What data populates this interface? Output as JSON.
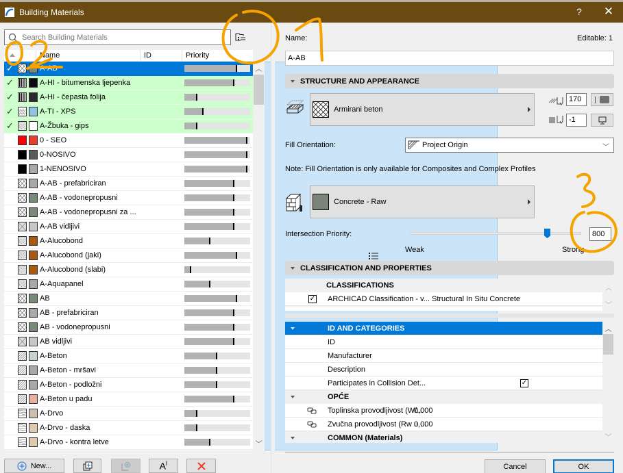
{
  "window": {
    "title": "Building Materials",
    "help_label": "?",
    "close_label": "✕",
    "title_bar_color": "#6a4a10"
  },
  "left": {
    "search_placeholder": "Search Building Materials",
    "view_modes": [
      "folder-view",
      "list-view"
    ],
    "active_view": "list-view",
    "columns": {
      "name": "Name",
      "id": "ID",
      "priority": "Priority"
    },
    "materials": [
      {
        "name": "A-AB",
        "in_use": true,
        "selected": true,
        "fill": "crosshatch",
        "surface": "#7a8a78",
        "priority": 0.8
      },
      {
        "name": "A-HI - bitumenska ljepenka",
        "in_use": true,
        "fill": "vbars",
        "surface": "#0a0a10",
        "priority": 0.76
      },
      {
        "name": "A-HI - čepasta folija",
        "in_use": true,
        "fill": "vbars",
        "surface": "#2a2a2a",
        "priority": 0.2
      },
      {
        "name": "A-TI - XPS",
        "in_use": true,
        "fill": "zigzag",
        "surface": "#8fc3e3",
        "priority": 0.29
      },
      {
        "name": "A-Žbuka - gips",
        "in_use": true,
        "fill": "dots",
        "surface": "#ffffff",
        "priority": 0.2
      },
      {
        "name": "0 - SEO",
        "fill": "solid-red",
        "surface": "#e8402a",
        "priority": 0.96
      },
      {
        "name": "0-NOSIVO",
        "fill": "solid-black",
        "surface": "#5a5a5a",
        "priority": 0.96
      },
      {
        "name": "1-NENOSIVO",
        "fill": "solid-black",
        "surface": "#a8a8a8",
        "priority": 0.96
      },
      {
        "name": "A-AB - prefabriciran",
        "fill": "crosshatch",
        "surface": "#a8a8a8",
        "priority": 0.76
      },
      {
        "name": "A-AB - vodonepropusni",
        "fill": "crosshatch",
        "surface": "#7a8a78",
        "priority": 0.76
      },
      {
        "name": "A-AB - vodonepropusni za ...",
        "fill": "crosshatch",
        "surface": "#7a8a78",
        "priority": 0.76
      },
      {
        "name": "A-AB vidljivi",
        "fill": "crosshatch-gray",
        "surface": "#c8c8c8",
        "priority": 0.76
      },
      {
        "name": "A-Alucobond",
        "fill": "dots",
        "surface": "#a85a10",
        "priority": 0.4
      },
      {
        "name": "A-Alucobond (jaki)",
        "fill": "dots",
        "surface": "#a85a10",
        "priority": 0.8
      },
      {
        "name": "A-Alucobond (slabi)",
        "fill": "dots",
        "surface": "#a85a10",
        "priority": 0.1
      },
      {
        "name": "A-Aquapanel",
        "fill": "dots",
        "surface": "#a8a8a8",
        "priority": 0.4
      },
      {
        "name": "AB",
        "fill": "crosshatch",
        "surface": "#7a8a78",
        "priority": 0.8
      },
      {
        "name": "AB - prefabriciran",
        "fill": "crosshatch",
        "surface": "#a8a8a8",
        "priority": 0.76
      },
      {
        "name": "AB - vodonepropusni",
        "fill": "crosshatch",
        "surface": "#7a8a78",
        "priority": 0.76
      },
      {
        "name": "AB vidljivi",
        "fill": "crosshatch-gray",
        "surface": "#c8c8c8",
        "priority": 0.76
      },
      {
        "name": "A-Beton",
        "fill": "diagonal",
        "surface": "#c8d0d0",
        "priority": 0.5
      },
      {
        "name": "A-Beton - mršavi",
        "fill": "diagonal",
        "surface": "#a8a8a8",
        "priority": 0.5
      },
      {
        "name": "A-Beton - podložni",
        "fill": "diagonal",
        "surface": "#a8a8a8",
        "priority": 0.5
      },
      {
        "name": "A-Beton u padu",
        "fill": "diagonal",
        "surface": "#e8b0a0",
        "priority": 0.76
      },
      {
        "name": "A-Drvo",
        "fill": "wood",
        "surface": "#cbbfae",
        "priority": 0.2
      },
      {
        "name": "A-Drvo - daska",
        "fill": "wood",
        "surface": "#dccbb0",
        "priority": 0.2
      },
      {
        "name": "A-Drvo - kontra letve",
        "fill": "wood",
        "surface": "#dccbb0",
        "priority": 0.4
      }
    ],
    "buttons": {
      "new_label": "New...",
      "duplicate": "duplicate",
      "import": "import",
      "rename": "rename",
      "delete": "delete"
    }
  },
  "right": {
    "name_label": "Name:",
    "editable_label": "Editable: 1",
    "name_value": "A-AB",
    "structure_section": "STRUCTURE AND APPEARANCE",
    "cut_fill": "Armirani beton",
    "fill_pen": "170",
    "bg_pen": "-1",
    "fill_orientation_label": "Fill Orientation:",
    "fill_orientation_value": "Project Origin",
    "note": "Note: Fill Orientation is only available for Composites and Complex Profiles",
    "surface": "Concrete - Raw",
    "surface_color": "#7a8478",
    "intersection_label": "Intersection Priority:",
    "intersection_value": "800",
    "intersection_fraction": 0.8,
    "weak_label": "Weak",
    "strong_label": "Strong",
    "classification_section": "CLASSIFICATION AND PROPERTIES",
    "classifications_header": "CLASSIFICATIONS",
    "classification_item": "ARCHICAD Classification - v... Structural In Situ Concrete",
    "classification_checked": true,
    "properties": [
      {
        "type": "group",
        "label": "ID AND CATEGORIES",
        "selected": true
      },
      {
        "type": "item",
        "label": "ID"
      },
      {
        "type": "item",
        "label": "Manufacturer"
      },
      {
        "type": "item",
        "label": "Description"
      },
      {
        "type": "item",
        "label": "Participates in Collision Det...",
        "checkbox": true
      },
      {
        "type": "group",
        "label": "OPĆE"
      },
      {
        "type": "item",
        "label": "Toplinska provodljivost (W/...",
        "value": "0,000",
        "linked": true
      },
      {
        "type": "item",
        "label": "Zvučna provodljivost (Rw u ...",
        "value": "0,000",
        "linked": true
      },
      {
        "type": "group",
        "label": "COMMON (Materials)"
      }
    ],
    "cancel_label": "Cancel",
    "ok_label": "OK"
  },
  "annotations": {
    "marks": [
      "1",
      "2",
      "3"
    ],
    "color": "#f5a300"
  }
}
